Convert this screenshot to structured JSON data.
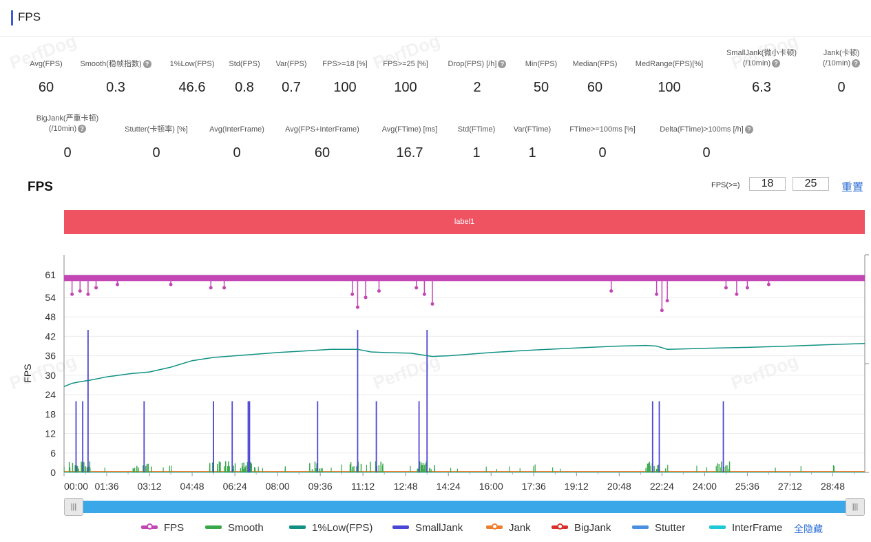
{
  "page": {
    "title": "FPS"
  },
  "watermark": "PerfDog",
  "metrics_row1": [
    {
      "label": "Avg(FPS)",
      "value": "60",
      "help": false
    },
    {
      "label": "Smooth(稳帧指数)",
      "value": "0.3",
      "help": true
    },
    {
      "label": "1%Low(FPS)",
      "value": "46.6",
      "help": false
    },
    {
      "label": "Std(FPS)",
      "value": "0.8",
      "help": false
    },
    {
      "label": "Var(FPS)",
      "value": "0.7",
      "help": false
    },
    {
      "label": "FPS>=18 [%]",
      "value": "100",
      "help": false
    },
    {
      "label": "FPS>=25 [%]",
      "value": "100",
      "help": false
    },
    {
      "label": "Drop(FPS) [/h]",
      "value": "2",
      "help": true
    },
    {
      "label": "Min(FPS)",
      "value": "50",
      "help": false
    },
    {
      "label": "Median(FPS)",
      "value": "60",
      "help": false
    },
    {
      "label": "MedRange(FPS)[%]",
      "value": "100",
      "help": false
    },
    {
      "label": "SmallJank(微小卡顿)",
      "label2": "(/10min)",
      "value": "6.3",
      "help": true
    },
    {
      "label": "Jank(卡顿)",
      "label2": "(/10min)",
      "value": "0",
      "help": true
    }
  ],
  "metrics_row2": [
    {
      "label": "BigJank(严重卡顿)",
      "label2": "(/10min)",
      "value": "0",
      "help": true
    },
    {
      "label": "Stutter(卡顿率) [%]",
      "value": "0",
      "help": false
    },
    {
      "label": "Avg(InterFrame)",
      "value": "0",
      "help": false
    },
    {
      "label": "Avg(FPS+InterFrame)",
      "value": "60",
      "help": false
    },
    {
      "label": "Avg(FTime) [ms]",
      "value": "16.7",
      "help": false
    },
    {
      "label": "Std(FTime)",
      "value": "1",
      "help": false
    },
    {
      "label": "Var(FTime)",
      "value": "1",
      "help": false
    },
    {
      "label": "FTime>=100ms [%]",
      "value": "0",
      "help": false
    },
    {
      "label": "Delta(FTime)>100ms [/h]",
      "value": "0",
      "help": true
    }
  ],
  "section": {
    "title": "FPS"
  },
  "fps_threshold": {
    "label": "FPS(>=)",
    "value1": "18",
    "value2": "25",
    "reset_label": "重置"
  },
  "label_bar": {
    "text": "label1"
  },
  "scrollbar": {
    "left_handle": "|||",
    "right_handle": "|||"
  },
  "legend": {
    "items": [
      {
        "name": "FPS",
        "color": "#c346b4",
        "marker": true
      },
      {
        "name": "Smooth",
        "color": "#3aa84a",
        "marker": false
      },
      {
        "name": "1%Low(FPS)",
        "color": "#109184",
        "marker": false
      },
      {
        "name": "SmallJank",
        "color": "#4b47d6",
        "marker": false
      },
      {
        "name": "Jank",
        "color": "#f07d2e",
        "marker": true
      },
      {
        "name": "BigJank",
        "color": "#d9302c",
        "marker": true
      },
      {
        "name": "Stutter",
        "color": "#4a8fe0",
        "marker": false
      },
      {
        "name": "InterFrame",
        "color": "#1ec8d4",
        "marker": false
      }
    ],
    "hide_all": "全隐藏"
  },
  "chart_data": {
    "type": "line",
    "ylabel": "FPS",
    "ylim": [
      0,
      61
    ],
    "yticks": [
      0,
      6,
      12,
      18,
      24,
      30,
      36,
      42,
      48,
      54,
      61
    ],
    "xticks": [
      "00:00",
      "01:36",
      "03:12",
      "04:48",
      "06:24",
      "08:00",
      "09:36",
      "11:12",
      "12:48",
      "14:24",
      "16:00",
      "17:36",
      "19:12",
      "20:48",
      "22:24",
      "24:00",
      "25:36",
      "27:12",
      "28:48"
    ],
    "xlim_minutes": [
      0,
      30
    ],
    "grid": true,
    "series": [
      {
        "name": "FPS",
        "baseline": 60,
        "dips": [
          {
            "t": 0.3,
            "v": 55
          },
          {
            "t": 0.6,
            "v": 56
          },
          {
            "t": 0.9,
            "v": 55
          },
          {
            "t": 1.2,
            "v": 57
          },
          {
            "t": 2.0,
            "v": 58
          },
          {
            "t": 4.0,
            "v": 58
          },
          {
            "t": 5.5,
            "v": 57
          },
          {
            "t": 6.0,
            "v": 57
          },
          {
            "t": 10.8,
            "v": 55
          },
          {
            "t": 11.0,
            "v": 51
          },
          {
            "t": 11.3,
            "v": 54
          },
          {
            "t": 11.8,
            "v": 56
          },
          {
            "t": 13.2,
            "v": 57
          },
          {
            "t": 13.5,
            "v": 55
          },
          {
            "t": 13.8,
            "v": 52
          },
          {
            "t": 20.5,
            "v": 56
          },
          {
            "t": 22.2,
            "v": 55
          },
          {
            "t": 22.4,
            "v": 50
          },
          {
            "t": 22.6,
            "v": 53
          },
          {
            "t": 24.8,
            "v": 57
          },
          {
            "t": 25.2,
            "v": 55
          },
          {
            "t": 25.6,
            "v": 57
          },
          {
            "t": 26.4,
            "v": 58
          }
        ]
      },
      {
        "name": "1%Low(FPS)",
        "t": [
          0,
          0.3,
          0.6,
          1.0,
          1.6,
          2.5,
          3.2,
          4.0,
          4.8,
          5.6,
          6.4,
          7.2,
          8.0,
          9.0,
          10.0,
          11.0,
          11.5,
          12.0,
          13.0,
          13.8,
          14.4,
          16.0,
          17.6,
          19.2,
          20.8,
          21.8,
          22.2,
          22.6,
          24.0,
          25.6,
          27.2,
          28.8,
          30.0
        ],
        "values": [
          26.5,
          27.5,
          28.0,
          28.5,
          29.5,
          30.5,
          31.0,
          32.5,
          34.5,
          35.5,
          36.0,
          36.5,
          37.0,
          37.5,
          38.0,
          38.0,
          37.2,
          37.0,
          36.8,
          35.8,
          36.0,
          37.0,
          37.8,
          38.4,
          39.0,
          39.2,
          39.0,
          38.0,
          38.3,
          38.6,
          39.0,
          39.5,
          39.8
        ]
      },
      {
        "name": "SmallJank",
        "spikes": [
          {
            "t": 0.45,
            "v": 22
          },
          {
            "t": 0.7,
            "v": 22
          },
          {
            "t": 0.9,
            "v": 44
          },
          {
            "t": 3.0,
            "v": 22
          },
          {
            "t": 5.6,
            "v": 22
          },
          {
            "t": 6.3,
            "v": 22
          },
          {
            "t": 6.9,
            "v": 22
          },
          {
            "t": 6.95,
            "v": 22
          },
          {
            "t": 9.5,
            "v": 22
          },
          {
            "t": 11.0,
            "v": 44
          },
          {
            "t": 11.7,
            "v": 22
          },
          {
            "t": 13.3,
            "v": 22
          },
          {
            "t": 13.6,
            "v": 44
          },
          {
            "t": 22.05,
            "v": 22
          },
          {
            "t": 22.3,
            "v": 22
          },
          {
            "t": 24.7,
            "v": 22
          }
        ]
      },
      {
        "name": "Smooth",
        "baseline": 0,
        "note": "small bursts up to ~2-3 near jank points"
      },
      {
        "name": "Jank",
        "values_constant": 0
      },
      {
        "name": "BigJank",
        "values_constant": 0
      },
      {
        "name": "Stutter",
        "values_constant": 0
      },
      {
        "name": "InterFrame",
        "values_constant": 0
      }
    ]
  }
}
